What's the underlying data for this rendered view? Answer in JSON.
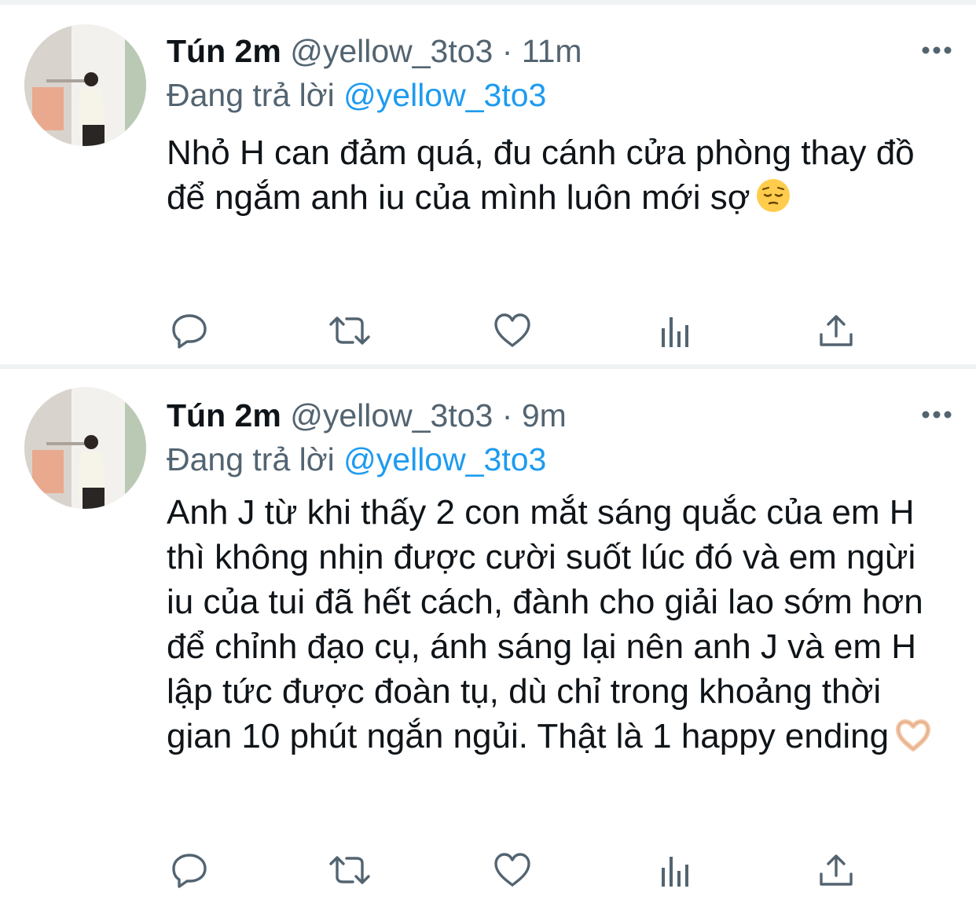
{
  "tweets": [
    {
      "author_name": "Tún 2m",
      "handle": "@yellow_3to3",
      "separator": "·",
      "time": "11m",
      "reply_prefix": "Đang trả lời",
      "reply_to": "@yellow_3to3",
      "text": "Nhỏ H can đảm quá, đu cánh cửa phòng thay đồ để ngắm anh iu của mình luôn mới sợ",
      "emoji_icon": "pensive-face-icon"
    },
    {
      "author_name": "Tún 2m",
      "handle": "@yellow_3to3",
      "separator": "·",
      "time": "9m",
      "reply_prefix": "Đang trả lời",
      "reply_to": "@yellow_3to3",
      "text": "Anh J từ khi thấy 2 con mắt sáng quắc của em H thì không nhịn được cười suốt lúc đó và em ngừi iu của tui đã hết cách, đành cho giải lao sớm hơn để chỉnh đạo cụ, ánh sáng lại nên anh J và em H lập tức được đoàn tụ, dù chỉ trong khoảng thời gian 10 phút ngắn ngủi. Thật là 1 happy ending",
      "emoji_icon": "heart-hands-icon"
    }
  ],
  "colors": {
    "text": "#0f1419",
    "secondary": "#536471",
    "link": "#1d9bf0",
    "divider": "#eff3f4"
  },
  "action_icons": [
    "reply-icon",
    "retweet-icon",
    "like-icon",
    "views-icon",
    "share-icon"
  ]
}
